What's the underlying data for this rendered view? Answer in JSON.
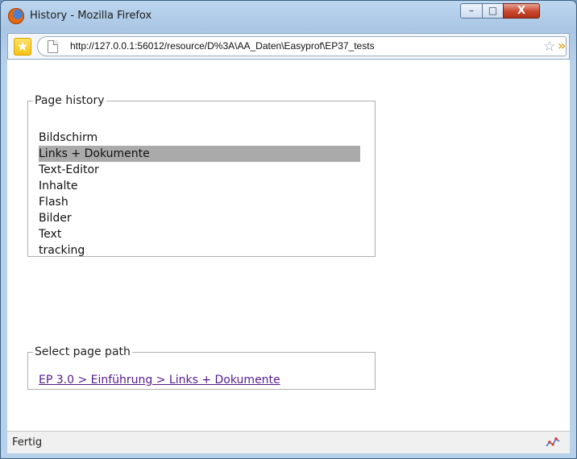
{
  "window": {
    "title": "History - Mozilla Firefox",
    "min_label": "–",
    "max_label": "□",
    "close_label": "X"
  },
  "address_bar": {
    "url": "http://127.0.0.1:56012/resource/D%3A\\AA_Daten\\Easyprof\\EP37_tests",
    "star": "★",
    "bookmark_star": "☆",
    "go_arrows": "»"
  },
  "history": {
    "legend": "Page history",
    "items": [
      {
        "label": "Bildschirm",
        "selected": false
      },
      {
        "label": "Links + Dokumente",
        "selected": true
      },
      {
        "label": "Text-Editor",
        "selected": false
      },
      {
        "label": "Inhalte",
        "selected": false
      },
      {
        "label": "Flash",
        "selected": false
      },
      {
        "label": "Bilder",
        "selected": false
      },
      {
        "label": "Text",
        "selected": false
      },
      {
        "label": "tracking",
        "selected": false
      }
    ]
  },
  "path": {
    "legend": "Select page path",
    "link": "EP 3.0 > Einführung > Links + Dokumente"
  },
  "status": {
    "text": "Fertig"
  },
  "colors": {
    "selected_bg": "#aaaaaa",
    "visited_link": "#551a8b",
    "close_button": "#c8462d"
  },
  "icons": [
    "firefox-logo-icon",
    "minimize-icon",
    "maximize-icon",
    "close-icon",
    "bookmark-star-icon",
    "page-icon",
    "add-bookmark-star-icon",
    "go-arrows-icon",
    "activity-graph-icon"
  ]
}
